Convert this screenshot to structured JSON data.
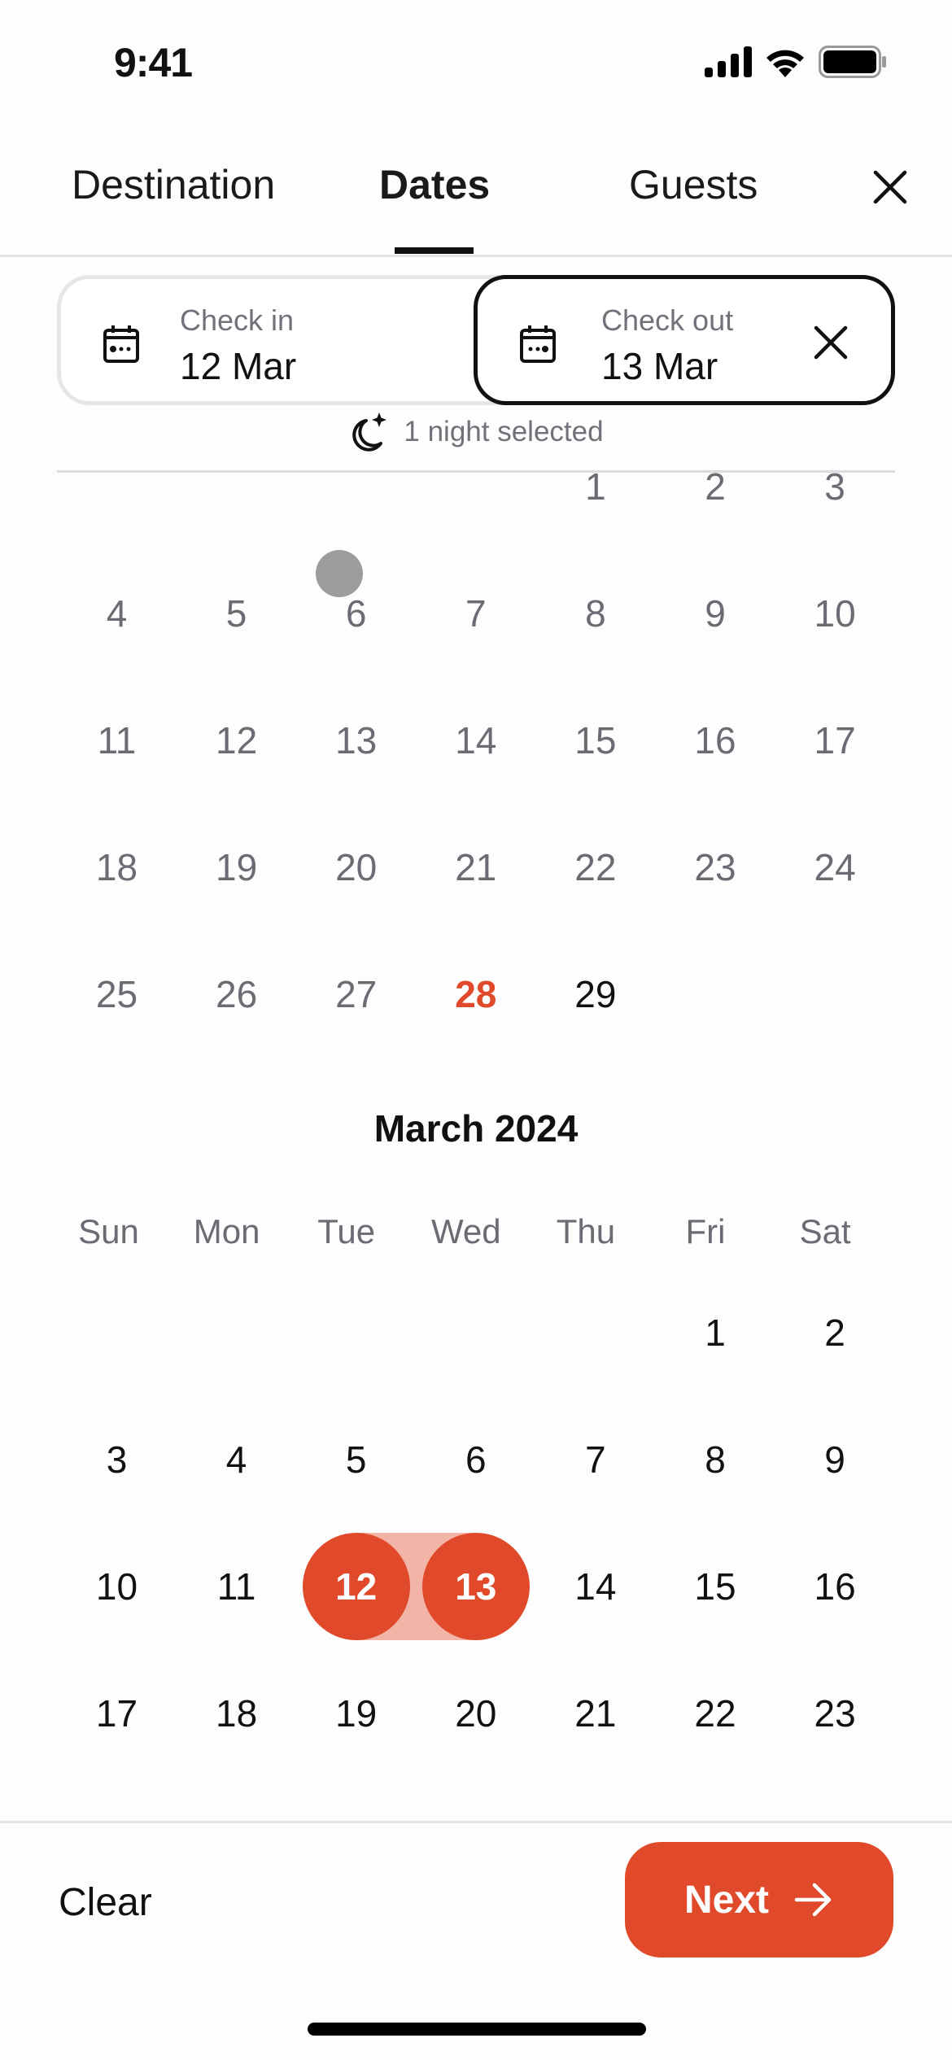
{
  "status_bar": {
    "time": "9:41"
  },
  "tabs": [
    {
      "label": "Destination",
      "active": false
    },
    {
      "label": "Dates",
      "active": true
    },
    {
      "label": "Guests",
      "active": false
    }
  ],
  "date_inputs": {
    "check_in": {
      "label": "Check in",
      "value": "12 Mar"
    },
    "check_out": {
      "label": "Check out",
      "value": "13 Mar"
    }
  },
  "nights_text": "1 night selected",
  "colors": {
    "accent": "#e04a2a",
    "range": "#f2b4a6",
    "muted": "#6b6b73"
  },
  "february": {
    "first_weekday": 4,
    "days": 29,
    "first_row_partial": true,
    "today": 28,
    "available_from": 29
  },
  "march": {
    "title": "March 2024",
    "weekdays": [
      "Sun",
      "Mon",
      "Tue",
      "Wed",
      "Thu",
      "Fri",
      "Sat"
    ],
    "first_weekday": 5,
    "visible_days": 23,
    "selected_start": 12,
    "selected_end": 13
  },
  "footer": {
    "clear_label": "Clear",
    "next_label": "Next"
  }
}
